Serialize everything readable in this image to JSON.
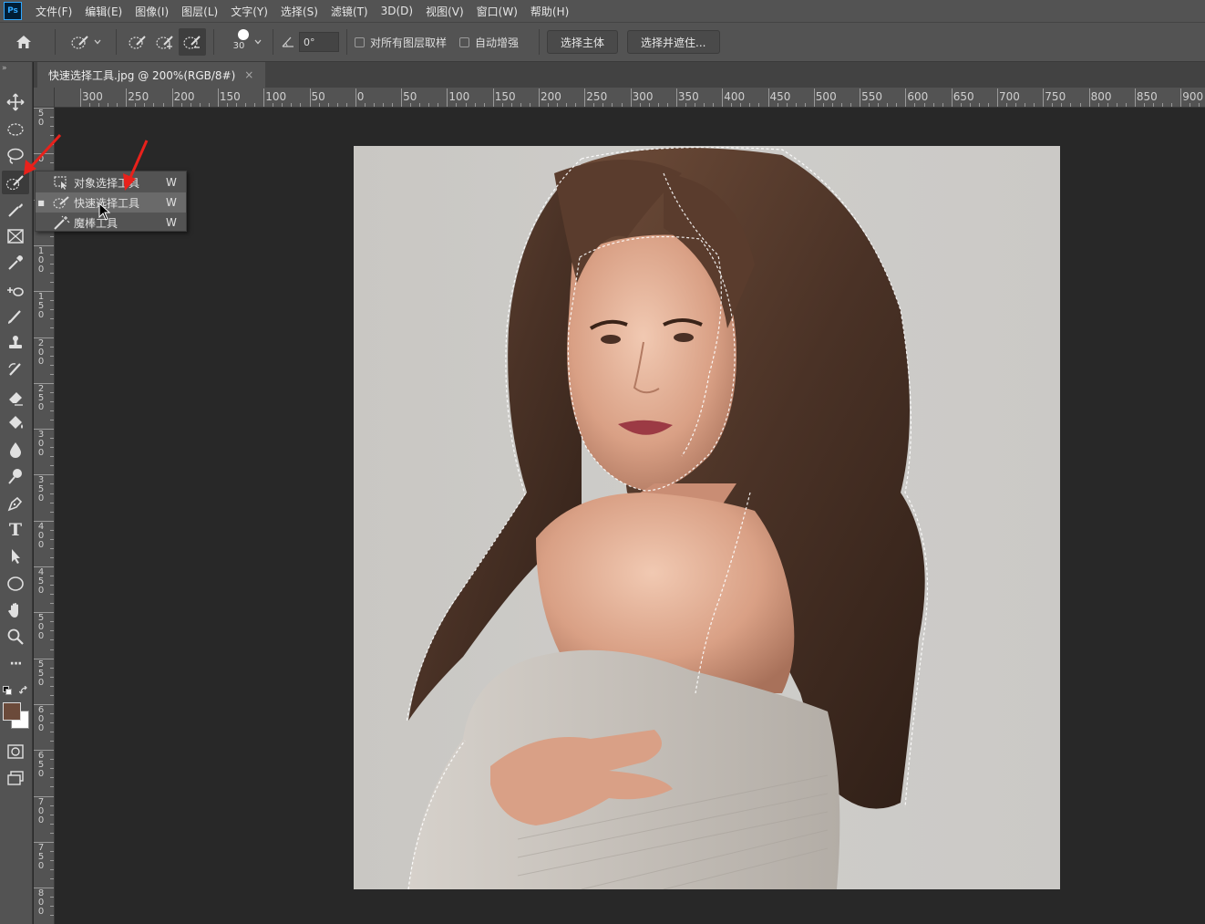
{
  "app": {
    "logo_text": "Ps"
  },
  "menubar": {
    "items": [
      "文件(F)",
      "编辑(E)",
      "图像(I)",
      "图层(L)",
      "文字(Y)",
      "选择(S)",
      "滤镜(T)",
      "3D(D)",
      "视图(V)",
      "窗口(W)",
      "帮助(H)"
    ]
  },
  "options": {
    "brush_size": "30",
    "angle_value": "0°",
    "sample_all_layers_label": "对所有图层取样",
    "auto_enhance_label": "自动增强",
    "select_subject_label": "选择主体",
    "select_and_mask_label": "选择并遮住..."
  },
  "toolbar": {
    "collapse_glyph": "»",
    "text_tool_glyph": "T",
    "more_glyph": "···"
  },
  "document": {
    "tab_title": "快速选择工具.jpg @ 200%(RGB/8#)",
    "close_glyph": "×"
  },
  "ruler": {
    "h_labels": [
      "300",
      "250",
      "200",
      "150",
      "100",
      "50",
      "0",
      "50",
      "100",
      "150",
      "200",
      "250",
      "300",
      "350",
      "400",
      "450",
      "500",
      "550",
      "600",
      "650",
      "700",
      "750",
      "800",
      "850",
      "900"
    ],
    "v_labels": [
      "50",
      "0",
      "50",
      "100",
      "150",
      "200",
      "250",
      "300",
      "350",
      "400",
      "450",
      "500",
      "550",
      "600",
      "650",
      "700",
      "750",
      "800"
    ]
  },
  "flyout": {
    "items": [
      {
        "label": "对象选择工具",
        "shortcut": "W",
        "selected": false
      },
      {
        "label": "快速选择工具",
        "shortcut": "W",
        "selected": true
      },
      {
        "label": "魔棒工具",
        "shortcut": "W",
        "selected": false
      }
    ],
    "bullet": "■"
  },
  "colors": {
    "foreground": "#6b4a3a",
    "background": "#ffffff",
    "annotation_arrow": "#e8211b"
  }
}
